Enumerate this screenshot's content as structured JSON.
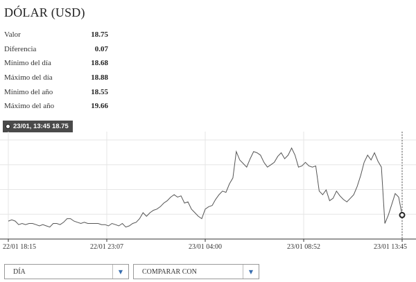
{
  "title": "DÓLAR (USD)",
  "stats": [
    {
      "label": "Valor",
      "value": "18.75"
    },
    {
      "label": "Diferencia",
      "value": "0.07"
    },
    {
      "label": "Mínimo del día",
      "value": "18.68"
    },
    {
      "label": "Máximo del día",
      "value": "18.88"
    },
    {
      "label": "Mínimo del año",
      "value": "18.55"
    },
    {
      "label": "Máximo del año",
      "value": "19.66"
    }
  ],
  "tooltip": {
    "text": "23/01, 13:45 18.75"
  },
  "chart_data": {
    "type": "line",
    "x_tick_labels": [
      "22/01 18:15",
      "22/01 23:07",
      "23/01 04:00",
      "23/01 08:52",
      "23/01 13:45"
    ],
    "series": [
      {
        "values": [
          18.7,
          18.71,
          18.7,
          18.67,
          18.68,
          18.67,
          18.68,
          18.68,
          18.67,
          18.66,
          18.67,
          18.66,
          18.65,
          18.68,
          18.68,
          18.67,
          18.69,
          18.72,
          18.72,
          18.7,
          18.69,
          18.68,
          18.69,
          18.68,
          18.68,
          18.68,
          18.68,
          18.67,
          18.67,
          18.66,
          18.68,
          18.67,
          18.66,
          18.68,
          18.65,
          18.66,
          18.68,
          18.69,
          18.72,
          18.77,
          18.74,
          18.77,
          18.79,
          18.8,
          18.82,
          18.85,
          18.87,
          18.9,
          18.92,
          18.9,
          18.91,
          18.85,
          18.86,
          18.8,
          18.77,
          18.74,
          18.72,
          18.8,
          18.82,
          18.83,
          18.88,
          18.92,
          18.95,
          18.94,
          19.01,
          19.06,
          19.28,
          19.21,
          19.18,
          19.15,
          19.22,
          19.28,
          19.27,
          19.25,
          19.19,
          19.15,
          19.17,
          19.19,
          19.24,
          19.27,
          19.22,
          19.25,
          19.31,
          19.25,
          19.15,
          19.16,
          19.19,
          19.16,
          19.15,
          19.16,
          18.95,
          18.92,
          18.96,
          18.87,
          18.89,
          18.95,
          18.91,
          18.88,
          18.86,
          18.89,
          18.92,
          18.99,
          19.08,
          19.19,
          19.25,
          19.21,
          19.27,
          19.2,
          19.15,
          18.68,
          18.75,
          18.84,
          18.93,
          18.9,
          18.75
        ]
      }
    ],
    "ylim": [
      18.55,
      19.4
    ],
    "grid": true
  },
  "controls": {
    "period": {
      "label": "DÍA"
    },
    "compare": {
      "label": "COMPARAR CON"
    }
  }
}
